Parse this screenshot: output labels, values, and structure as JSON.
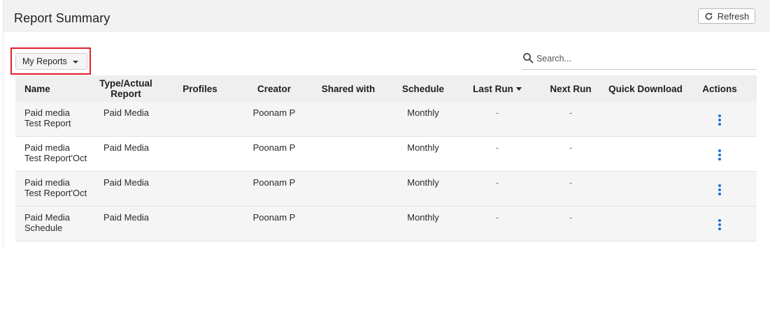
{
  "header": {
    "title": "Report Summary",
    "refresh_label": "Refresh"
  },
  "filter": {
    "selected": "My Reports"
  },
  "search": {
    "placeholder": "Search..."
  },
  "table": {
    "columns": {
      "name": "Name",
      "type_line1": "Type/Actual",
      "type_line2": "Report",
      "profiles": "Profiles",
      "creator": "Creator",
      "shared_with": "Shared with",
      "schedule": "Schedule",
      "last_run": "Last Run",
      "next_run": "Next Run",
      "quick_download": "Quick Download",
      "actions": "Actions"
    },
    "rows": [
      {
        "name_line1": "Paid media",
        "name_line2": "Test Report",
        "type": "Paid Media",
        "profiles": "",
        "creator": "Poonam P",
        "shared_with": "",
        "schedule": "Monthly",
        "last_run": "-",
        "next_run": "-",
        "quick_download": ""
      },
      {
        "name_line1": "Paid media",
        "name_line2": "Test Report'Oct",
        "type": "Paid Media",
        "profiles": "",
        "creator": "Poonam P",
        "shared_with": "",
        "schedule": "Monthly",
        "last_run": "-",
        "next_run": "-",
        "quick_download": ""
      },
      {
        "name_line1": "Paid media",
        "name_line2": "Test Report'Oct",
        "type": "Paid Media",
        "profiles": "",
        "creator": "Poonam P",
        "shared_with": "",
        "schedule": "Monthly",
        "last_run": "-",
        "next_run": "-",
        "quick_download": ""
      },
      {
        "name_line1": "Paid Media",
        "name_line2": "Schedule",
        "type": "Paid Media",
        "profiles": "",
        "creator": "Poonam P",
        "shared_with": "",
        "schedule": "Monthly",
        "last_run": "-",
        "next_run": "-",
        "quick_download": ""
      }
    ]
  },
  "colors": {
    "accent": "#1a73d9",
    "highlight": "#e0202a",
    "header_bg": "#f2f2f2"
  },
  "icons": {
    "refresh": "refresh-icon",
    "dropdown": "caret-down-icon",
    "search": "search-icon",
    "sort": "sort-desc-icon",
    "row_actions": "kebab-menu-icon"
  }
}
